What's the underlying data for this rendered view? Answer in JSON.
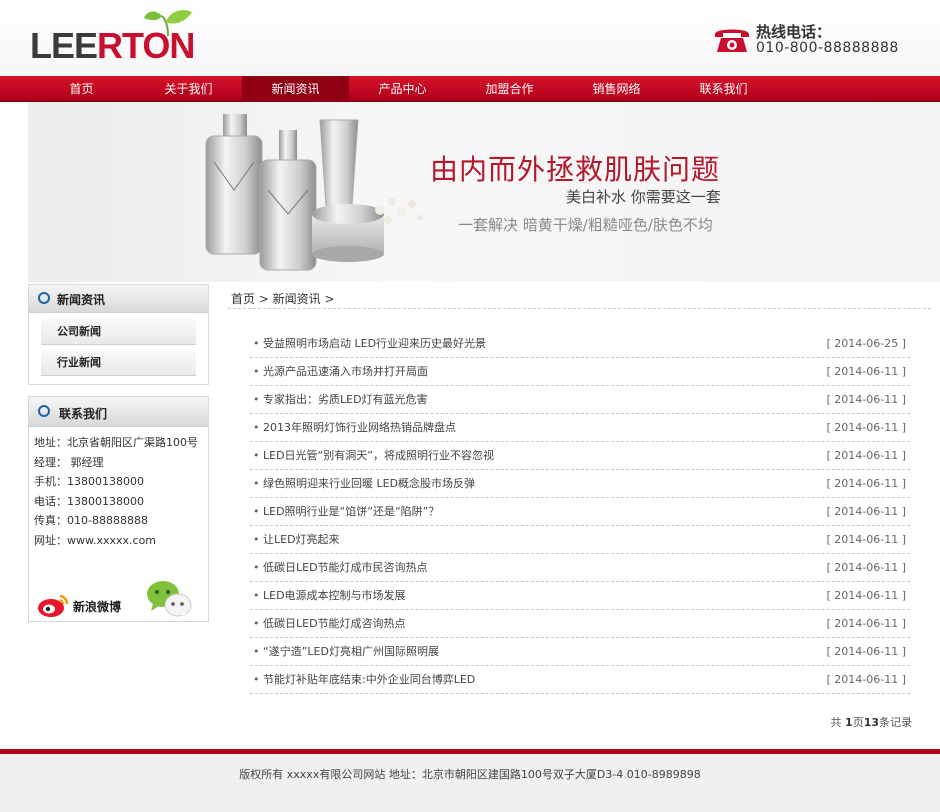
{
  "header": {
    "logo_part1": "LEE",
    "logo_part2": "RTON",
    "hotline_label": "热线电话：",
    "hotline_number": "010-800-88888888"
  },
  "nav": {
    "items": [
      {
        "label": "首页"
      },
      {
        "label": "关于我们"
      },
      {
        "label": "新闻资讯"
      },
      {
        "label": "产品中心"
      },
      {
        "label": "加盟合作"
      },
      {
        "label": "销售网络"
      },
      {
        "label": "联系我们"
      }
    ],
    "active_index": 2
  },
  "banner": {
    "headline": "由内而外拯救肌肤问题",
    "subline": "美白补水  你需要这一套",
    "tagline": "一套解决 暗黄干燥/粗糙哑色/肤色不均"
  },
  "sidebar": {
    "news_box": {
      "title": "新闻资讯",
      "categories": [
        {
          "label": "公司新闻"
        },
        {
          "label": "行业新闻"
        }
      ]
    },
    "contact_box": {
      "title": "联系我们",
      "lines": [
        "地址：北京省朝阳区广渠路100号",
        "经理： 郭经理",
        "手机：13800138000",
        "电话：13800138000",
        "传真：010-88888888",
        "网址：www.xxxxx.com"
      ],
      "weibo_label": "新浪微博"
    }
  },
  "main": {
    "breadcrumb": "首页 > 新闻资讯 >",
    "news": [
      {
        "title": "受益照明市场启动 LED行业迎来历史最好光景",
        "date": "[ 2014-06-25 ]"
      },
      {
        "title": "光源产品迅速涌入市场并打开局面",
        "date": "[ 2014-06-11 ]"
      },
      {
        "title": "专家指出：劣质LED灯有蓝光危害",
        "date": "[ 2014-06-11 ]"
      },
      {
        "title": "2013年照明灯饰行业网络热销品牌盘点",
        "date": "[ 2014-06-11 ]"
      },
      {
        "title": "LED日光管“别有洞天”，将成照明行业不容忽视",
        "date": "[ 2014-06-11 ]"
      },
      {
        "title": "绿色照明迎来行业回暖 LED概念股市场反弹",
        "date": "[ 2014-06-11 ]"
      },
      {
        "title": "LED照明行业是“馅饼”还是“陷阱”？",
        "date": "[ 2014-06-11 ]"
      },
      {
        "title": "让LED灯亮起来",
        "date": "[ 2014-06-11 ]"
      },
      {
        "title": "低碳日LED节能灯成市民咨询热点",
        "date": "[ 2014-06-11 ]"
      },
      {
        "title": "LED电源成本控制与市场发展",
        "date": "[ 2014-06-11 ]"
      },
      {
        "title": "低碳日LED节能灯成咨询热点",
        "date": "[ 2014-06-11 ]"
      },
      {
        "title": "“遂宁造”LED灯亮相广州国际照明展",
        "date": "[ 2014-06-11 ]"
      },
      {
        "title": "节能灯补贴年底结束:中外企业同台博弈LED",
        "date": "[ 2014-06-11 ]"
      }
    ],
    "pager": {
      "prefix": "共 ",
      "pages": "1",
      "mid": "页",
      "count": "13",
      "suffix": "条记录"
    }
  },
  "footer": {
    "text": "版权所有 xxxxx有限公司网站 地址：北京市朝阳区建国路100号双子大厦D3-4 010-8989898"
  },
  "colors": {
    "brand_red": "#c8102e",
    "nav_red": "#b1001a",
    "nav_active": "#8f0014",
    "accent_blue": "#1e63a8"
  }
}
